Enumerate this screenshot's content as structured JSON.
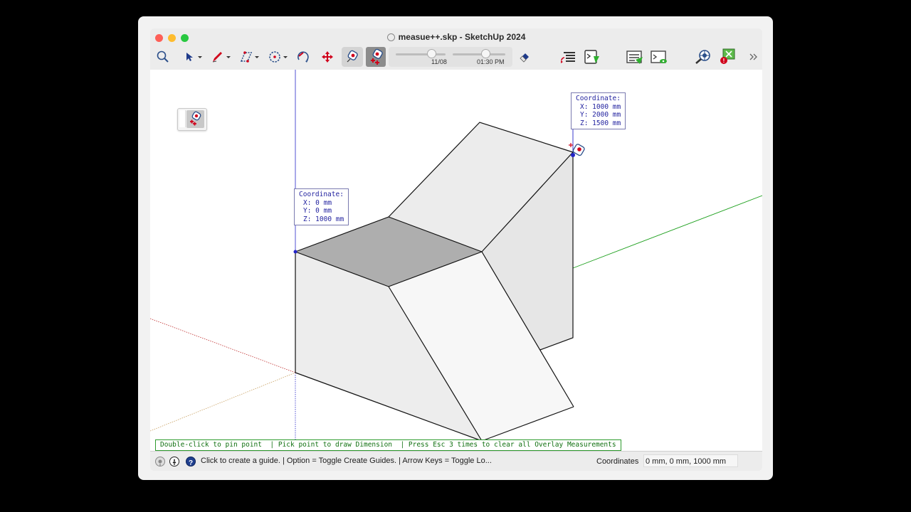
{
  "window": {
    "title": "measue++.skp - SketchUp 2024"
  },
  "toolbar": {
    "tools": [
      {
        "name": "search-icon"
      },
      {
        "name": "select-arrow-icon"
      },
      {
        "name": "pencil-icon"
      },
      {
        "name": "rectangle-icon"
      },
      {
        "name": "circle-icon"
      },
      {
        "name": "rotate-icon"
      },
      {
        "name": "move-icon"
      },
      {
        "name": "measure-point-icon"
      },
      {
        "name": "measure-plus-icon"
      },
      {
        "name": "eraser-icon"
      },
      {
        "name": "list-refresh-icon"
      },
      {
        "name": "ruby-console-icon"
      },
      {
        "name": "report-icon"
      },
      {
        "name": "view-console-icon"
      },
      {
        "name": "inspect-icon"
      },
      {
        "name": "warning-board-icon"
      },
      {
        "name": "more-chevron-icon"
      }
    ],
    "shadow_date_label": "11/08",
    "shadow_time_label": "01:30 PM",
    "shadow_date_level": 0.72,
    "shadow_time_level": 0.62,
    "accent_color": "#d0021b"
  },
  "viewport": {
    "coord_box_top": {
      "title": "Coordinate:",
      "x": "X: 1000 mm",
      "y": "Y: 2000 mm",
      "z": "Z: 1500 mm"
    },
    "coord_box_left": {
      "title": "Coordinate:",
      "x": "X: 0 mm",
      "y": "Y: 0 mm",
      "z": "Z: 1000 mm"
    },
    "hint": "Double-click to pin point  | Pick point to draw Dimension  | Press Esc 3 times to clear all Overlay Measurements",
    "axis_colors": {
      "blue": "#2424c8",
      "green": "#1ea01e",
      "red": "#c03030"
    }
  },
  "statusbar": {
    "icons": [
      "location-pin-icon",
      "info-icon",
      "help-icon"
    ],
    "text": "Click to create a guide. | Option = Toggle Create Guides. | Arrow Keys = Toggle Lo...",
    "measurement_label": "Coordinates",
    "measurement_value": "0 mm, 0 mm, 1000 mm"
  }
}
